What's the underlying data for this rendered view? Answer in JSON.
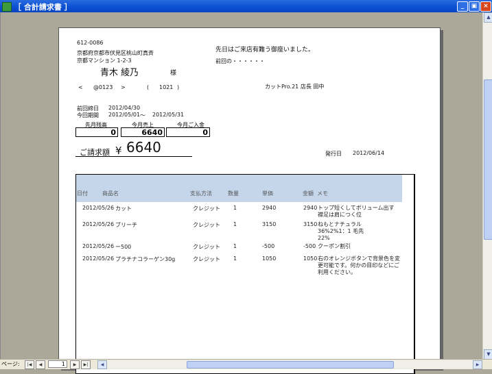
{
  "window": {
    "title": "［ 合計請求書 ］",
    "min_glyph": "_",
    "max_glyph": "▣",
    "close_glyph": "×"
  },
  "invoice": {
    "postal": "612-0086",
    "address1": "京都府京都市伏見区桃山町真斉",
    "address2": "京都マンション 1-2-3",
    "customer_name": "青木 綾乃",
    "honorific": "様",
    "cust_open": "<",
    "cust_id": "@0123",
    "cust_close": ">",
    "paren_open": "(",
    "cust_no": "1021",
    "paren_close": ")",
    "greeting1": "先日はご来店有難う御座いました。",
    "greeting2": "前回の・・・・・・",
    "shop": "カットPro.21  店長  田中",
    "last_close_label": "前回締日",
    "last_close_date": "2012/04/30",
    "period_label": "今回期間",
    "period_from": "2012/05/01",
    "period_sep": "～",
    "period_to": "2012/05/31",
    "prev_balance_label": "先月残高",
    "prev_balance": "0",
    "sales_label": "今月売上",
    "sales": "6640",
    "deposit_label": "今月ご入金",
    "deposit": "0",
    "total_label": "ご請求額",
    "currency": "¥",
    "total": "6640",
    "issue_label": "発行日",
    "issue_date": "2012/06/14"
  },
  "table": {
    "headers": [
      "日付",
      "商品名",
      "支払方法",
      "数量",
      "単価",
      "金額",
      "メモ"
    ],
    "rows": [
      {
        "date": "2012/05/26",
        "item": "カット",
        "pay": "クレジット",
        "qty": "1",
        "price": "2940",
        "amount": "2940",
        "memo": "トップ短くしてボリューム出す  襟足は肩につく位"
      },
      {
        "date": "2012/05/26",
        "item": "ブリーチ",
        "pay": "クレジット",
        "qty": "1",
        "price": "3150",
        "amount": "3150",
        "memo": "ねもとナチュラル 36%2%1：1 毛先22%"
      },
      {
        "date": "2012/05/26",
        "item": "ー500",
        "pay": "クレジット",
        "qty": "1",
        "price": "-500",
        "amount": "-500",
        "memo": "クーポン割引"
      },
      {
        "date": "2012/05/26",
        "item": "プラチナコラーゲン30g",
        "pay": "クレジット",
        "qty": "1",
        "price": "1050",
        "amount": "1050",
        "memo": "右のオレンジボタンで背景色を変更可能です。何かの目印などにご利用ください。"
      }
    ]
  },
  "statusbar": {
    "page_label": "ページ:",
    "page_number": "1",
    "first": "|◀",
    "prev": "◀",
    "next": "▶",
    "last": "▶|"
  },
  "scroll": {
    "up": "▲",
    "down": "▼",
    "left": "◀",
    "right": "▶"
  }
}
